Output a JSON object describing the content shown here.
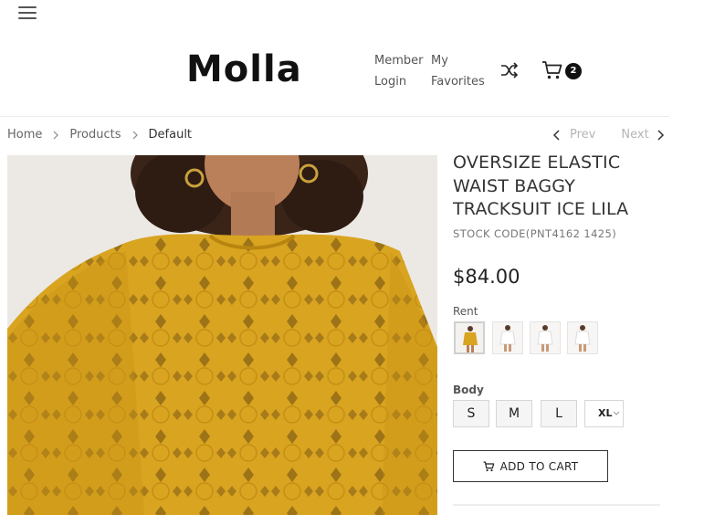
{
  "header": {
    "logo": "Molla",
    "nav": {
      "member_line1": "Member",
      "member_line2": "Login",
      "fav_line1": "My",
      "fav_line2": "Favorites"
    },
    "cart_count": "2",
    "icons": [
      "menu-icon",
      "shuffle-icon",
      "cart-icon"
    ]
  },
  "breadcrumb": {
    "items": [
      "Home",
      "Products",
      "Default"
    ]
  },
  "pager": {
    "prev": "Prev",
    "next": "Next"
  },
  "product": {
    "title": "OVERSIZE ELASTIC WAIST BAGGY TRACKSUIT ICE LILA",
    "stock_code": "STOCK CODE(PNT4162 1425)",
    "price": "$84.00",
    "rent_label": "Rent",
    "body_label": "Body",
    "sizes": [
      "S",
      "M",
      "L"
    ],
    "selected_size": "XL",
    "add_to_cart": "ADD TO CART"
  },
  "colors": {
    "mustard": "#d9a420",
    "accent": "#111111"
  }
}
